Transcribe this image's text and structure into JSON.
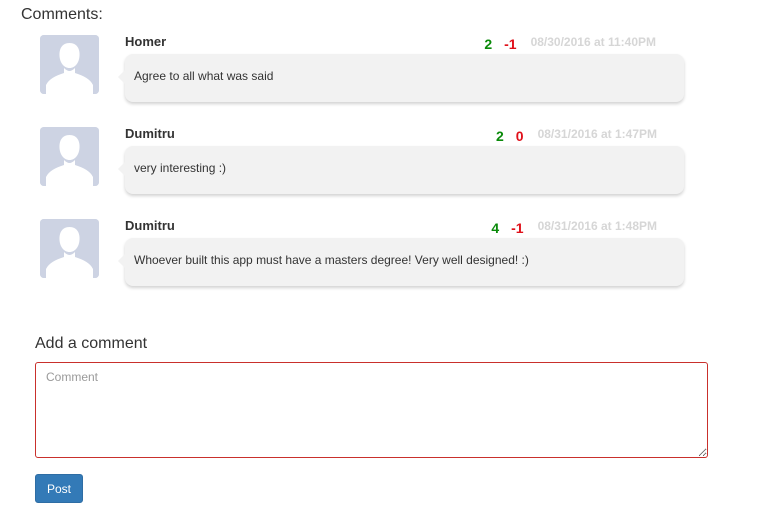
{
  "comments_section": {
    "heading": "Comments:"
  },
  "comments": [
    {
      "author": "Homer",
      "upvotes": "2",
      "downvotes": "-1",
      "timestamp": "08/30/2016 at 11:40PM",
      "text": "Agree to all what was said"
    },
    {
      "author": "Dumitru",
      "upvotes": "2",
      "downvotes": "0",
      "timestamp": "08/31/2016 at 1:47PM",
      "text": "very interesting :)"
    },
    {
      "author": "Dumitru",
      "upvotes": "4",
      "downvotes": "-1",
      "timestamp": "08/31/2016 at 1:48PM",
      "text": "Whoever built this app must have a masters degree! Very well designed! :)"
    }
  ],
  "add_comment": {
    "heading": "Add a comment",
    "placeholder": "Comment",
    "value": "",
    "post_label": "Post"
  },
  "colors": {
    "upvote": "#0a8a0a",
    "downvote": "#e0101a",
    "timestamp": "#d6d6d6",
    "bubble": "#f2f2f2",
    "avatar_bg": "#cdd3e3",
    "post_button": "#337ab7",
    "input_border": "#c9302c"
  },
  "icons": {
    "avatar": "user-silhouette-icon"
  }
}
